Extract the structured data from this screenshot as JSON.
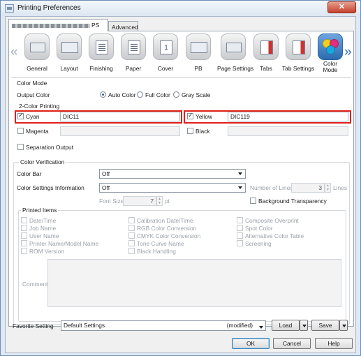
{
  "window": {
    "title": "Printing Preferences",
    "close": "✕"
  },
  "tabs": {
    "printer_tab": "PS",
    "advanced_tab": "Advanced"
  },
  "toolbar": {
    "items": [
      {
        "label": "General"
      },
      {
        "label": "Layout"
      },
      {
        "label": "Finishing"
      },
      {
        "label": "Paper"
      },
      {
        "label": "Cover",
        "glyph": "1"
      },
      {
        "label": "PB"
      },
      {
        "label": "Page Settings"
      },
      {
        "label": "Tabs"
      },
      {
        "label": "Tab Settings"
      },
      {
        "label_line1": "Color",
        "label_line2": "Mode"
      }
    ],
    "scroll_left": "«",
    "scroll_right": "»"
  },
  "color_mode": {
    "section": "Color Mode",
    "output_label": "Output Color",
    "options": [
      "Auto Color",
      "Full Color",
      "Gray Scale"
    ],
    "selected": "Auto Color"
  },
  "two_color": {
    "section": "2-Color Printing",
    "cyan": {
      "label": "Cyan",
      "checked": true,
      "value": "DIC11"
    },
    "yellow": {
      "label": "Yellow",
      "checked": true,
      "value": "DIC119"
    },
    "magenta": {
      "label": "Magenta",
      "checked": false,
      "value": ""
    },
    "black": {
      "label": "Black",
      "checked": false,
      "value": ""
    }
  },
  "separation": {
    "label": "Separation Output"
  },
  "verification": {
    "section": "Color Verification",
    "color_bar_label": "Color Bar",
    "color_bar_value": "Off",
    "settings_info_label": "Color Settings Information",
    "settings_info_value": "Off",
    "lines_label": "Number of Lines",
    "lines_value": "3",
    "lines_unit": "Lines",
    "font_size_label": "Font Size",
    "font_size_value": "7",
    "font_size_unit": "pt",
    "background_label": "Background Transparency"
  },
  "printed_items": {
    "section": "Printed Items",
    "col1": [
      "Date/Time",
      "Job Name",
      "User Name",
      "Printer Name/Model Name",
      "ROM Version"
    ],
    "col2": [
      "Calibration Date/Time",
      "RGB Color Conversion",
      "CMYK Color Conversion",
      "Tone Curve Name",
      "Black Handling"
    ],
    "col3": [
      "Composite Overprint",
      "Spot Color",
      "Alternative Color Table",
      "Screening"
    ],
    "comment_label": "Comment"
  },
  "favorite": {
    "label": "Favorite Setting",
    "value": "Default Settings",
    "status": "(modified)",
    "load": "Load",
    "save": "Save"
  },
  "buttons": {
    "ok": "OK",
    "cancel": "Cancel",
    "help": "Help"
  }
}
